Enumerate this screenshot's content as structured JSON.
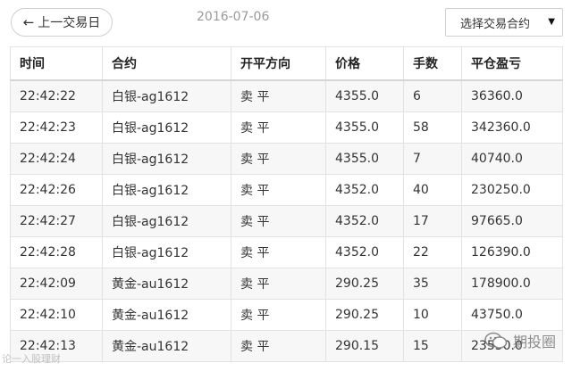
{
  "header": {
    "prev_button_label": "上一交易日",
    "date": "2016-07-06",
    "contract_select_label": "选择交易合约"
  },
  "table": {
    "columns": [
      "时间",
      "合约",
      "开平方向",
      "价格",
      "手数",
      "平仓盈亏"
    ],
    "rows": [
      [
        "22:42:22",
        "白银-ag1612",
        "卖 平",
        "4355.0",
        "6",
        "36360.0"
      ],
      [
        "22:42:23",
        "白银-ag1612",
        "卖 平",
        "4355.0",
        "58",
        "342360.0"
      ],
      [
        "22:42:24",
        "白银-ag1612",
        "卖 平",
        "4355.0",
        "7",
        "40740.0"
      ],
      [
        "22:42:26",
        "白银-ag1612",
        "卖 平",
        "4352.0",
        "40",
        "230250.0"
      ],
      [
        "22:42:27",
        "白银-ag1612",
        "卖 平",
        "4352.0",
        "17",
        "97665.0"
      ],
      [
        "22:42:28",
        "白银-ag1612",
        "卖 平",
        "4352.0",
        "22",
        "126390.0"
      ],
      [
        "22:42:09",
        "黄金-au1612",
        "卖 平",
        "290.25",
        "35",
        "178900.0"
      ],
      [
        "22:42:10",
        "黄金-au1612",
        "卖 平",
        "290.25",
        "10",
        "43750.0"
      ],
      [
        "22:42:13",
        "黄金-au1612",
        "卖 平",
        "290.15",
        "15",
        "23550.0"
      ]
    ]
  },
  "watermarks": {
    "left_text": "论一入股理财",
    "right_text": "期投圈"
  },
  "icons": {
    "prev": "arrow-left-icon",
    "select": "caret-down-icon",
    "watermark": "wechat-logo-icon"
  }
}
